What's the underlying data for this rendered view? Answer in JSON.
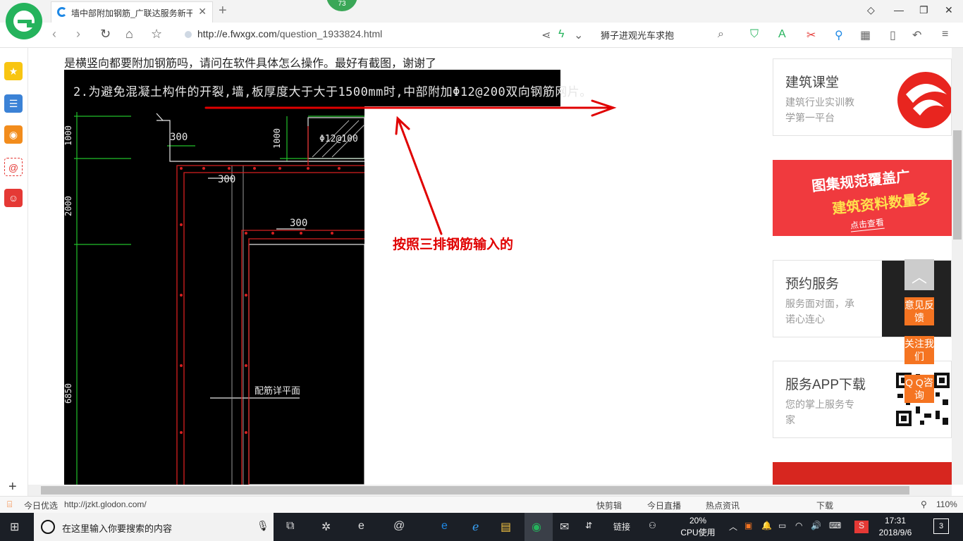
{
  "browser": {
    "tab_title": "墙中部附加钢筋_广联达服务新干",
    "tab_close": "✕",
    "new_tab": "+",
    "badge": "73",
    "url_domain": "http://e.fwxgx.com",
    "url_path": "/question_1933824.html",
    "search_text": "狮子进观光车求抱"
  },
  "page": {
    "question": "是横竖向都要附加钢筋吗，请问在软件具体怎么操作。最好有截图，谢谢了",
    "cad_title": "2.为避免混凝土构件的开裂,墙,板厚度大于大于1500mm时,中部附加Φ12@200双向钢筋网片。",
    "cad_labels": {
      "l300a": "300",
      "l300b": "300",
      "l300c": "300",
      "l1000a": "1000",
      "l1000b": "1000",
      "l2000": "2000",
      "l6850": "6850",
      "rebar": "Φ12@100",
      "section": "配筋详平面"
    },
    "annotation": "按照三排钢筋输入的"
  },
  "ads": {
    "ad1": {
      "title": "建筑课堂",
      "sub": "建筑行业实训教学第一平台"
    },
    "ad2": {
      "line1": "图集规范覆盖广",
      "line2": "建筑资料数量多",
      "button": "点击查看"
    },
    "ad3": {
      "title": "预约服务",
      "sub": "服务面对面，承诺心连心"
    },
    "ad4": {
      "title": "服务APP下载",
      "sub": "您的掌上服务专家"
    }
  },
  "float": {
    "feedback": "意见反馈",
    "follow": "关注我们",
    "qq": "Q Q咨询"
  },
  "status": {
    "today_label": "今日优选",
    "link_url": "http://jzkt.glodon.com/",
    "items": [
      "快剪辑",
      "今日直播",
      "热点资讯",
      "下载"
    ],
    "zoom": "110%"
  },
  "taskbar": {
    "search_placeholder": "在这里输入你要搜索的内容",
    "links": "链接",
    "cpu_pct": "20%",
    "cpu_label": "CPU使用",
    "time": "17:31",
    "date": "2018/9/6",
    "notif_count": "3",
    "ime_label": "S"
  },
  "colors": {
    "accent_green": "#25b35c",
    "annotation_red": "#e00000",
    "float_orange": "#f57421"
  }
}
